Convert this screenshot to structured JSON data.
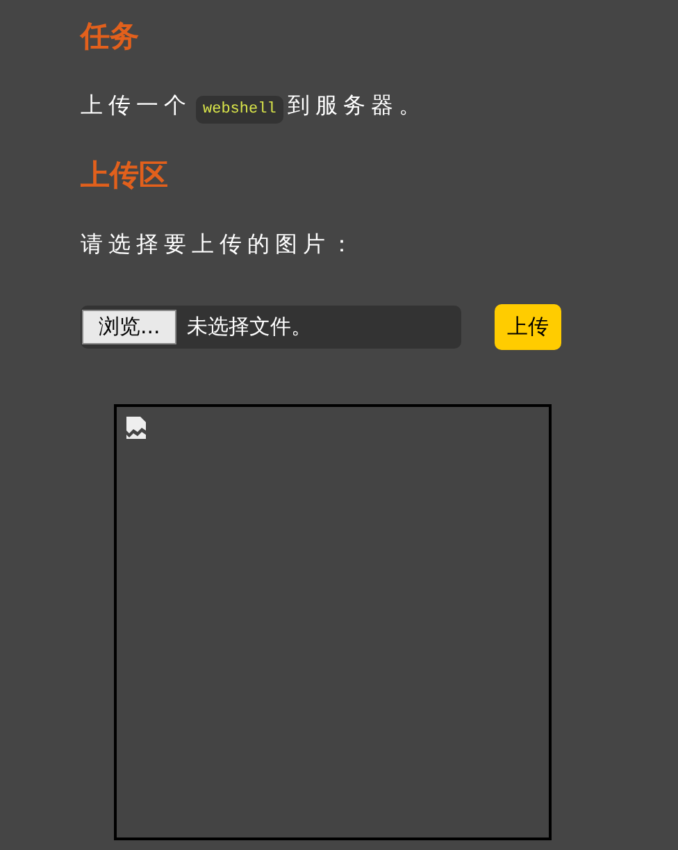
{
  "task": {
    "heading": "任务",
    "text_before": "上传一个",
    "code": "webshell",
    "text_after": "到服务器。"
  },
  "upload": {
    "heading": "上传区",
    "prompt": "请选择要上传的图片：",
    "browse_button": "浏览...",
    "file_status": "未选择文件。",
    "submit_button": "上传"
  },
  "preview": {
    "image_broken": true
  }
}
